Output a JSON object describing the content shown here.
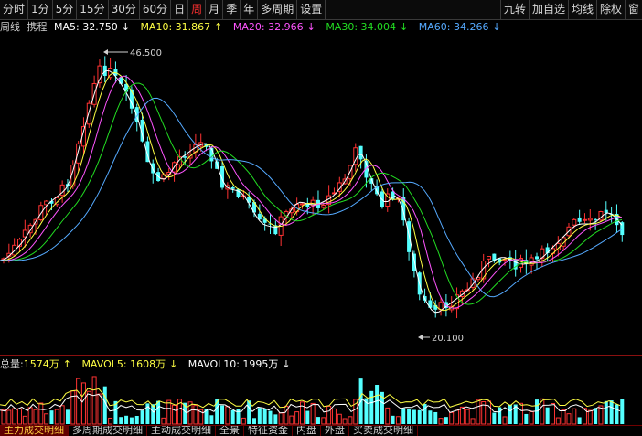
{
  "toolbar": {
    "left": [
      "分时",
      "1分",
      "5分",
      "15分",
      "30分",
      "60分",
      "日",
      "周",
      "月",
      "季",
      "年",
      "多周期",
      "设置"
    ],
    "active": "周",
    "right": [
      "九转",
      "加自选",
      "均线",
      "除权",
      "窗"
    ]
  },
  "ma_line": {
    "period": "周线",
    "adjust": "携程",
    "ma": [
      {
        "label": "MA5: 32.750",
        "arrow": "↓",
        "color": "#ffffff"
      },
      {
        "label": "MA10: 31.867",
        "arrow": "↑",
        "color": "#ffff44"
      },
      {
        "label": "MA20: 32.966",
        "arrow": "↓",
        "color": "#ff55ff"
      },
      {
        "label": "MA30: 34.004",
        "arrow": "↓",
        "color": "#22dd22"
      },
      {
        "label": "MA60: 34.266",
        "arrow": "↓",
        "color": "#55aaff"
      }
    ]
  },
  "price_chart": {
    "high_label": "46.500",
    "low_label": "20.100",
    "colors": {
      "up": "#ff3333",
      "down": "#54ffff"
    }
  },
  "volume_line": {
    "label": "总量:",
    "total": "1574万",
    "total_arrow": "↑",
    "mavol5": "MAVOL5: 1608万",
    "mavol5_arrow": "↓",
    "mavol10": "MAVOL10: 1995万",
    "mavol10_arrow": "↓"
  },
  "tabs": [
    "主力成交明细",
    "多周期成交明细",
    "主动成交明细",
    "全景",
    "特征资金",
    "内盘",
    "外盘",
    "买卖成交明细"
  ],
  "active_tab": "主力成交明细"
}
